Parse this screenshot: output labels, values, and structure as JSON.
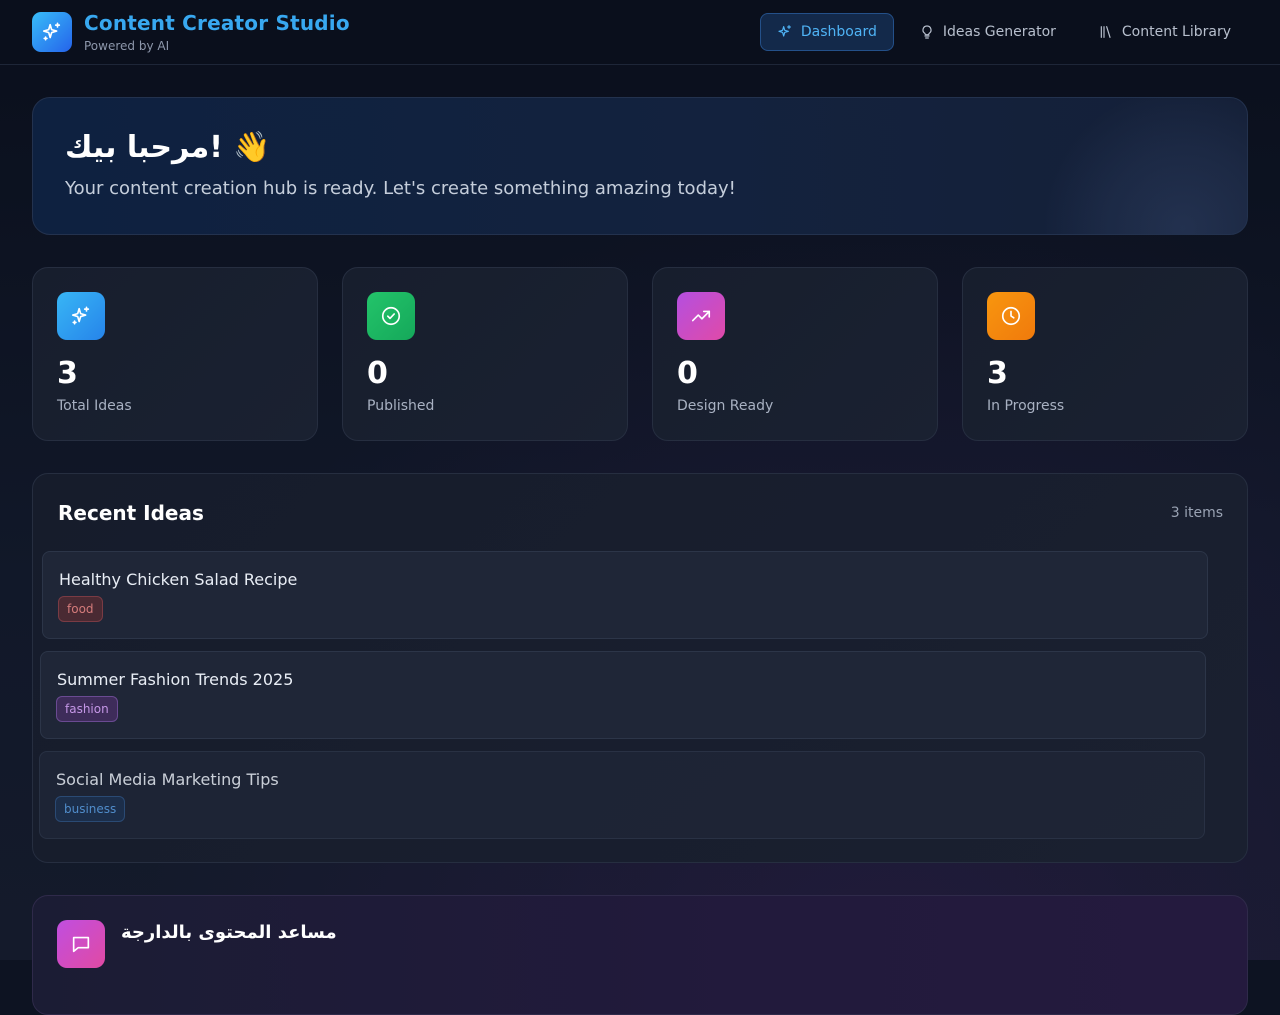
{
  "header": {
    "title": "Content Creator Studio",
    "subtitle": "Powered by AI",
    "nav": [
      {
        "label": "Dashboard",
        "icon": "sparkles-icon",
        "active": true
      },
      {
        "label": "Ideas Generator",
        "icon": "lightbulb-icon",
        "active": false
      },
      {
        "label": "Content Library",
        "icon": "library-icon",
        "active": false
      }
    ]
  },
  "hero": {
    "title": "مرحبا بيك! 👋",
    "subtitle": "Your content creation hub is ready. Let's create something amazing today!"
  },
  "stats": [
    {
      "value": "3",
      "label": "Total Ideas",
      "icon": "sparkles-icon",
      "color": "#2b9cf0"
    },
    {
      "value": "0",
      "label": "Published",
      "icon": "check-circle-icon",
      "color": "#22c55e"
    },
    {
      "value": "0",
      "label": "Design Ready",
      "icon": "trending-up-icon",
      "color": "#c54fd8"
    },
    {
      "value": "3",
      "label": "In Progress",
      "icon": "clock-icon",
      "color": "#f5890f"
    }
  ],
  "recent": {
    "title": "Recent Ideas",
    "count": "3 items",
    "items": [
      {
        "title": "Healthy Chicken Salad Recipe",
        "tag": "food"
      },
      {
        "title": "Summer Fashion Trends 2025",
        "tag": "fashion"
      },
      {
        "title": "Social Media Marketing Tips",
        "tag": "business"
      }
    ]
  },
  "assistant": {
    "title": "مساعد المحتوى بالدارجة",
    "icon": "chat-icon"
  }
}
